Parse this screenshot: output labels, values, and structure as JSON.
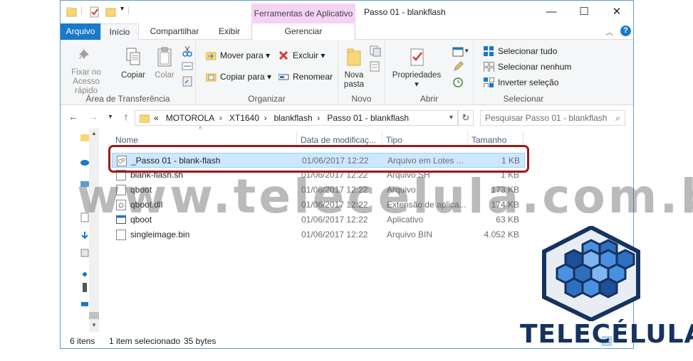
{
  "titlebar": {
    "context_tab": "Ferramentas de Aplicativo",
    "title": "Passo 01 - blankflash",
    "minimize": "—",
    "maximize": "☐",
    "close": "✕"
  },
  "tabs": [
    {
      "label": "Arquivo"
    },
    {
      "label": "Início"
    },
    {
      "label": "Compartilhar"
    },
    {
      "label": "Exibir"
    },
    {
      "label": "Gerenciar"
    }
  ],
  "ribbon": {
    "clipboard": {
      "pin_label": "Fixar no Acesso rápido",
      "copy_label": "Copiar",
      "paste_label": "Colar",
      "group_label": "Área de Transferência"
    },
    "organize": {
      "move_label": "Mover para",
      "copy_to_label": "Copiar para",
      "delete_label": "Excluir",
      "rename_label": "Renomear",
      "group_label": "Organizar"
    },
    "new": {
      "new_folder_label": "Nova pasta",
      "group_label": "Novo"
    },
    "open": {
      "properties_label": "Propriedades",
      "group_label": "Abrir"
    },
    "select": {
      "select_all": "Selecionar tudo",
      "select_none": "Selecionar nenhum",
      "invert": "Inverter seleção",
      "group_label": "Selecionar"
    }
  },
  "address": {
    "overflow": "«",
    "crumbs": [
      "MOTOROLA",
      "XT1640",
      "blankflash",
      "Passo 01 - blankflash"
    ],
    "search_placeholder": "Pesquisar Passo 01 - blankflash"
  },
  "columns": {
    "name": "Nome",
    "date": "Data de modificaç...",
    "type": "Tipo",
    "size": "Tamanho"
  },
  "files": [
    {
      "name": "_Passo 01 - blank-flash",
      "date": "01/06/2017 12:22",
      "type": "Arquivo em Lotes ...",
      "size": "1 KB",
      "icon": "batch-file-icon",
      "selected": true
    },
    {
      "name": "blank-flash.sh",
      "date": "01/06/2017 12:22",
      "type": "Arquivo SH",
      "size": "1 KB",
      "icon": "file-icon",
      "selected": false
    },
    {
      "name": "qboot",
      "date": "01/06/2017 12:22",
      "type": "Arquivo",
      "size": "173 KB",
      "icon": "file-icon",
      "selected": false
    },
    {
      "name": "qboot.dll",
      "date": "01/06/2017 12:22",
      "type": "Extensão de aplica...",
      "size": "174 KB",
      "icon": "dll-file-icon",
      "selected": false
    },
    {
      "name": "qboot",
      "date": "01/06/2017 12:22",
      "type": "Aplicativo",
      "size": "63 KB",
      "icon": "application-icon",
      "selected": false
    },
    {
      "name": "singleimage.bin",
      "date": "01/06/2017 12:22",
      "type": "Arquivo BIN",
      "size": "4.052 KB",
      "icon": "file-icon",
      "selected": false
    }
  ],
  "status": {
    "item_count": "6 itens",
    "selected": "1 item selecionado",
    "size": "35 bytes"
  },
  "watermark": "www.telecelula.com.br",
  "brand": "TELECÉLULA",
  "colors": {
    "accent": "#1979ca",
    "selection": "#cce8ff",
    "highlight_border": "#9b1a1a",
    "context_tab": "#f5d3f4",
    "brand": "#15335f"
  }
}
